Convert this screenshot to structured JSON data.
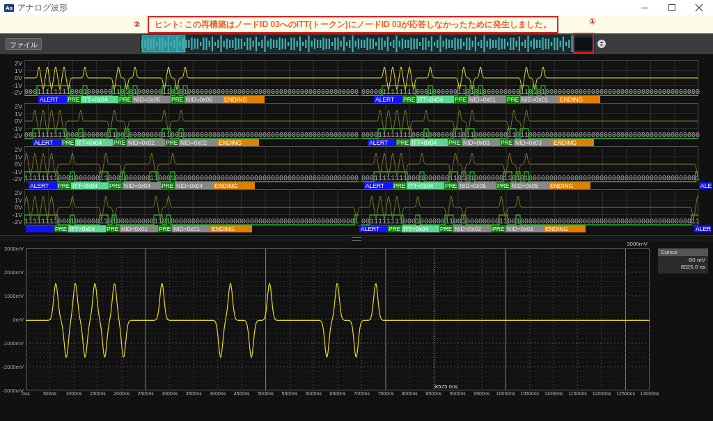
{
  "window": {
    "icon_text": "As",
    "title": "アナログ波形"
  },
  "hint": {
    "marker": "②",
    "text": "ヒント: この再構築はノードID 03へのITT(トークン)にノードID 03が応答しなかったために発生しました。"
  },
  "toolbar": {
    "file_button": "ファイル",
    "overview_marker": "①"
  },
  "trace_rows": [
    {
      "selected": true,
      "y_labels": [
        "2V",
        "1V",
        "0V",
        "-1V",
        "-2V"
      ],
      "bits": [
        "00011111111000100000011010100000011010100000000000000000000000000000000000000000",
        "000001111111100010000001101010000000001101010000000000000000000000000000000000000"
      ],
      "packets": [
        {
          "segments": [
            {
              "kind": "alert",
              "label": "ALERT"
            },
            {
              "kind": "pre",
              "label": "PRE"
            },
            {
              "kind": "itt",
              "label": "ITT=0x04"
            },
            {
              "kind": "pre",
              "label": "PRE"
            },
            {
              "kind": "nid",
              "label": "NID=0x05"
            },
            {
              "kind": "pre",
              "label": "PRE"
            },
            {
              "kind": "nid",
              "label": "NID=0x05"
            },
            {
              "kind": "ending",
              "label": "ENDING"
            }
          ]
        },
        {
          "segments": [
            {
              "kind": "alert",
              "label": "ALERT"
            },
            {
              "kind": "pre",
              "label": "PRE"
            },
            {
              "kind": "itt",
              "label": "ITT=0x04"
            },
            {
              "kind": "pre",
              "label": "PRE"
            },
            {
              "kind": "nid",
              "label": "NID=0x01"
            },
            {
              "kind": "pre",
              "label": "PRE"
            },
            {
              "kind": "nid",
              "label": "NID=0x01"
            },
            {
              "kind": "ending",
              "label": "ENDING"
            }
          ]
        }
      ]
    },
    {
      "selected": false,
      "y_labels": [
        "2V",
        "1V",
        "0V",
        "-1V",
        "-2V"
      ],
      "bits": [
        "00111111110001000000110010000000011001000000000000000000000000000000000000000000",
        "000011111111000100000011011000000001101100000000000000000000000000000000000000000"
      ],
      "packets": [
        {
          "segments": [
            {
              "kind": "alert",
              "label": "ALERT"
            },
            {
              "kind": "pre",
              "label": "PRE"
            },
            {
              "kind": "itt",
              "label": "ITT=0x04"
            },
            {
              "kind": "pre",
              "label": "PRE"
            },
            {
              "kind": "nid",
              "label": "NID=0x02"
            },
            {
              "kind": "pre",
              "label": "PRE"
            },
            {
              "kind": "nid",
              "label": "NID=0x02"
            },
            {
              "kind": "ending",
              "label": "ENDING"
            }
          ]
        },
        {
          "segments": [
            {
              "kind": "alert",
              "label": "ALERT"
            },
            {
              "kind": "pre",
              "label": "PRE"
            },
            {
              "kind": "itt",
              "label": "ITT=0x04"
            },
            {
              "kind": "pre",
              "label": "PRE"
            },
            {
              "kind": "nid",
              "label": "NID=0x03"
            },
            {
              "kind": "pre",
              "label": "PRE"
            },
            {
              "kind": "nid",
              "label": "NID=0x03"
            },
            {
              "kind": "ending",
              "label": "ENDING"
            }
          ]
        }
      ]
    },
    {
      "selected": false,
      "y_labels": [
        "2V",
        "1V",
        "0V",
        "-1V",
        "-2V"
      ],
      "bits": [
        "11111111000100000011000100000011000100000000000000000000000000000000000000000000",
        "000111111110001000000110101000000011010100000000000000000000000000000000000000001"
      ],
      "packets": [
        {
          "segments": [
            {
              "kind": "alert",
              "label": "ALERT"
            },
            {
              "kind": "pre",
              "label": "PRE"
            },
            {
              "kind": "itt",
              "label": "ITT=0x04"
            },
            {
              "kind": "pre",
              "label": "PRE"
            },
            {
              "kind": "nid",
              "label": "NID=0x04"
            },
            {
              "kind": "pre",
              "label": "PRE"
            },
            {
              "kind": "nid",
              "label": "NID=0x04"
            },
            {
              "kind": "ending",
              "label": "ENDING"
            }
          ]
        },
        {
          "segments": [
            {
              "kind": "alert",
              "label": "ALERT"
            },
            {
              "kind": "pre",
              "label": "PRE"
            },
            {
              "kind": "itt",
              "label": "ITT=0x04"
            },
            {
              "kind": "pre",
              "label": "PRE"
            },
            {
              "kind": "nid",
              "label": "NID=0x05"
            },
            {
              "kind": "pre",
              "label": "PRE"
            },
            {
              "kind": "nid",
              "label": "NID=0x05"
            },
            {
              "kind": "ending",
              "label": "ENDING"
            }
          ]
        },
        {
          "segments": [
            {
              "kind": "alert",
              "label": "ALE"
            }
          ]
        }
      ]
    },
    {
      "selected": false,
      "y_labels": [
        "2V",
        "1V",
        "0V",
        "-1V",
        "-2V"
      ],
      "bits": [
        "11111111000100000011010000000001101000000000000000000000000000000000000000000001",
        "001111111100010000001100100000000110010000000000000000000000000000000000000000011"
      ],
      "packets": [
        {
          "segments": [
            {
              "kind": "alert"
            },
            {
              "kind": "pre",
              "label": "PRE"
            },
            {
              "kind": "itt",
              "label": "ITT=0x04"
            },
            {
              "kind": "pre",
              "label": "PRE"
            },
            {
              "kind": "nid",
              "label": "NID=0x01"
            },
            {
              "kind": "pre",
              "label": "PRE"
            },
            {
              "kind": "nid",
              "label": "NID=0x01"
            },
            {
              "kind": "ending",
              "label": "ENDING"
            }
          ]
        },
        {
          "segments": [
            {
              "kind": "alert",
              "label": "ALERT"
            },
            {
              "kind": "pre",
              "label": "PRE"
            },
            {
              "kind": "itt",
              "label": "ITT=0x04"
            },
            {
              "kind": "pre",
              "label": "PRE"
            },
            {
              "kind": "nid",
              "label": "NID=0x02"
            },
            {
              "kind": "pre",
              "label": "PRE"
            },
            {
              "kind": "nid",
              "label": "NID=0x02"
            },
            {
              "kind": "ending",
              "label": "ENDING"
            }
          ]
        },
        {
          "segments": [
            {
              "kind": "alert",
              "label": "ALER"
            }
          ]
        }
      ]
    }
  ],
  "scope": {
    "top_label": "3000mV",
    "y_labels": [
      "3000mV",
      "2000mV",
      "1000mV",
      "0mV",
      "-1000mV",
      "-2000mV",
      "-3000mV"
    ],
    "x_labels": [
      "0us",
      "500ns",
      "1000ns",
      "1500ns",
      "2000ns",
      "2500ns",
      "3000ns",
      "3500ns",
      "4000ns",
      "4500ns",
      "5000ns",
      "5500ns",
      "6000ns",
      "6500ns",
      "7000ns",
      "7500ns",
      "8000ns",
      "8500ns",
      "9000ns",
      "9500ns",
      "10000ns",
      "10500ns",
      "11000ns",
      "11500ns",
      "12000ns",
      "12500ns",
      "13000ns"
    ],
    "cursor_label": "8525.0ns",
    "cursor_panel": {
      "title": "Cursor",
      "value": "-50 mV",
      "time": "8525.0 ns"
    }
  }
}
